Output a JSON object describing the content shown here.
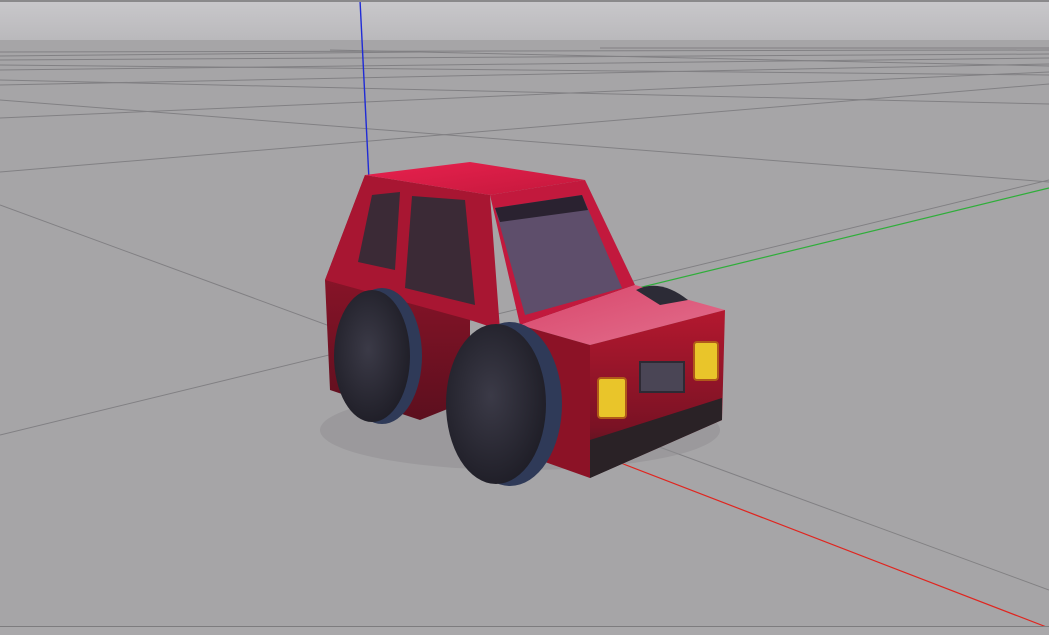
{
  "app": {
    "view": "3D viewport"
  },
  "scene": {
    "background_top": "#c7c5c8",
    "background_ground": "#a6a5a7",
    "grid_color": "#7f7e80",
    "axes": {
      "x_color": "#e0251f",
      "y_color": "#2fae3a",
      "z_color": "#1f2bd6"
    },
    "object": {
      "type": "car",
      "body_color": "#c0193a",
      "roof_color": "#e6204a",
      "window_color": "#5e4e6b",
      "tire_color": "#2c2b36",
      "rim_color": "#3a4a6a",
      "headlight_color": "#e9c52a"
    }
  }
}
